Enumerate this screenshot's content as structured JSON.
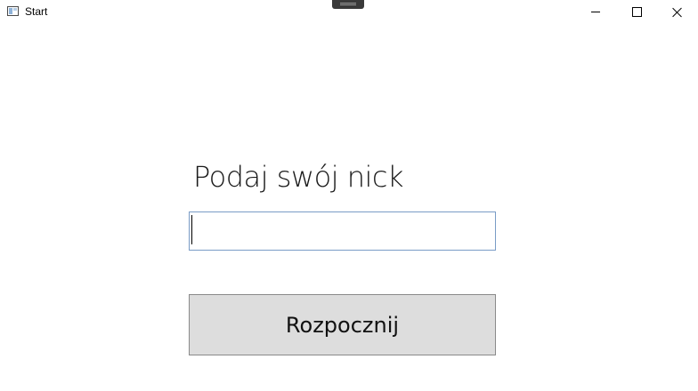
{
  "window": {
    "title": "Start",
    "icon": "app-window-icon",
    "controls": {
      "minimize_icon": "minimize-icon",
      "maximize_icon": "maximize-icon",
      "close_icon": "close-icon"
    }
  },
  "form": {
    "prompt_label": "Podaj swój nick",
    "nick_value": "",
    "start_label": "Rozpocznij"
  },
  "colors": {
    "input_border": "#7a9cc6",
    "button_background": "#dddddd",
    "button_border": "#8a8a8a"
  }
}
